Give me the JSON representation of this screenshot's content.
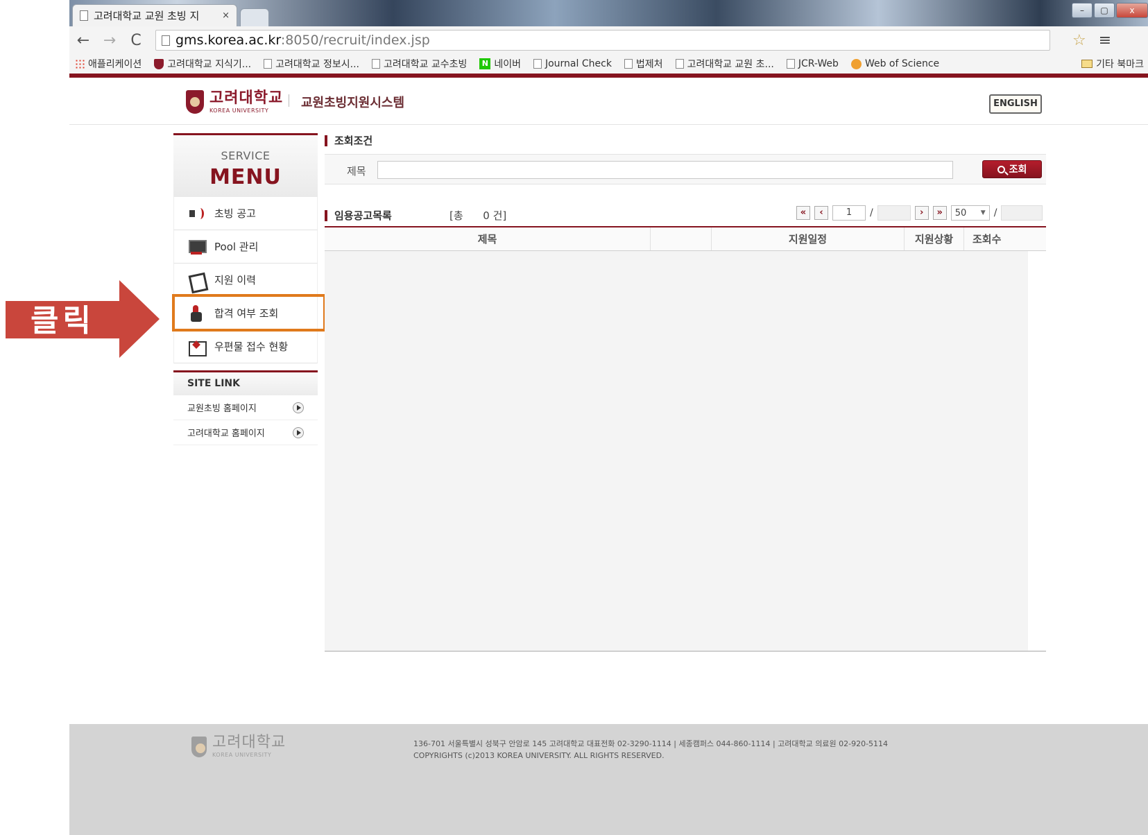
{
  "browser": {
    "tab_title": "고려대학교 교원 초빙 지",
    "tab_close": "×",
    "nav": {
      "back": "←",
      "forward": "→",
      "reload": "C"
    },
    "url_host": "gms.korea.ac.kr",
    "url_rest": ":8050/recruit/index.jsp",
    "window_controls": {
      "minimize": "–",
      "maximize": "▢",
      "close": "x"
    },
    "bookmarks": [
      {
        "label": "애플리케이션",
        "icon": "apps-icon"
      },
      {
        "label": "고려대학교 지식기...",
        "icon": "ku-icon"
      },
      {
        "label": "고려대학교 정보시...",
        "icon": "page-icon"
      },
      {
        "label": "고려대학교 교수초빙",
        "icon": "page-icon"
      },
      {
        "label": "네이버",
        "icon": "naver-icon",
        "icon_glyph": "N"
      },
      {
        "label": "Journal Check",
        "icon": "page-icon"
      },
      {
        "label": "법제처",
        "icon": "page-icon"
      },
      {
        "label": "고려대학교 교원 초...",
        "icon": "page-icon"
      },
      {
        "label": "JCR-Web",
        "icon": "page-icon"
      },
      {
        "label": "Web of Science",
        "icon": "wos-icon"
      }
    ],
    "bookmark_folder": "기타 북마크"
  },
  "header": {
    "logo_ko": "고려대학교",
    "logo_en": "KOREA UNIVERSITY",
    "system_title": "교원초빙지원시스템",
    "english_button": "ENGLISH"
  },
  "sidebar": {
    "menu_sub": "SERVICE",
    "menu_main": "MENU",
    "items": [
      {
        "label": "초빙 공고",
        "icon": "speaker-icon"
      },
      {
        "label": "Pool 관리",
        "icon": "monitor-icon"
      },
      {
        "label": "지원 이력",
        "icon": "clipboard-icon"
      },
      {
        "label": "합격 여부 조회",
        "icon": "hand-click-icon"
      },
      {
        "label": "우편물 접수 현황",
        "icon": "mail-icon"
      }
    ],
    "site_link_title": "SITE LINK",
    "site_links": [
      {
        "label": "교원초빙 홈페이지"
      },
      {
        "label": "고려대학교 홈페이지"
      }
    ]
  },
  "search": {
    "section_title": "조회조건",
    "label": "제목",
    "value": "",
    "button_label": "조회"
  },
  "list": {
    "section_title": "임용공고목록",
    "count_text": "[총      0 건]",
    "pager": {
      "first": "«",
      "prev": "‹",
      "page": "1",
      "sep": "/",
      "next": "›",
      "last": "»",
      "page_size": "50",
      "sep2": "/"
    },
    "columns": [
      "제목",
      "",
      "지원일정",
      "지원상황",
      "조회수"
    ]
  },
  "annotation": {
    "click_label": "클릭",
    "arrow_color": "#c9463c",
    "highlight_color": "#e07a1c"
  },
  "footer": {
    "logo_ko": "고려대학교",
    "logo_en": "KOREA UNIVERSITY",
    "address": "136-701 서울특별시 성북구 안암로 145 고려대학교 대표전화 02-3290-1114 | 세종캠퍼스 044-860-1114 | 고려대학교 의료원 02-920-5114",
    "copyright": "COPYRIGHTS (c)2013 KOREA UNIVERSITY. ALL RIGHTS RESERVED."
  },
  "colors": {
    "brand": "#86141f",
    "accent_button": "#b51d2c"
  }
}
